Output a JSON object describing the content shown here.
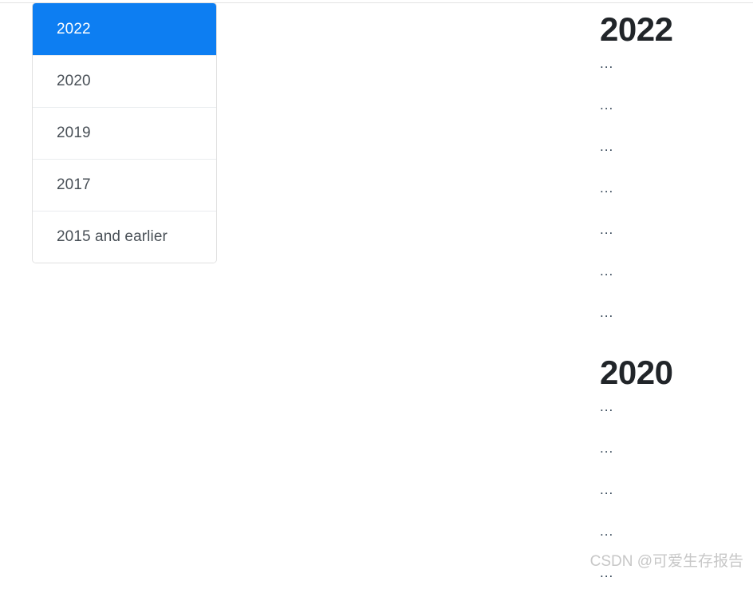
{
  "year_list": {
    "name": "year-filter-list",
    "items": [
      {
        "label": "2022",
        "active": true
      },
      {
        "label": "2020",
        "active": false
      },
      {
        "label": "2019",
        "active": false
      },
      {
        "label": "2017",
        "active": false
      },
      {
        "label": "2015 and earlier",
        "active": false
      }
    ]
  },
  "content": {
    "sections": [
      {
        "heading": "2022",
        "rows": [
          "...",
          "...",
          "...",
          "...",
          "...",
          "...",
          "..."
        ]
      },
      {
        "heading": "2020",
        "rows": [
          "...",
          "...",
          "...",
          "...",
          "..."
        ]
      }
    ]
  },
  "watermark": {
    "text": "CSDN @可爱生存报告"
  },
  "colors": {
    "active_background": "#0d7ef2",
    "active_text": "#ffffff",
    "item_text": "#495057",
    "heading_text": "#212529",
    "border": "#e0e0e0",
    "separator": "#e9ecef",
    "watermark_text": "#c7c7c7",
    "page_background": "#ffffff"
  }
}
